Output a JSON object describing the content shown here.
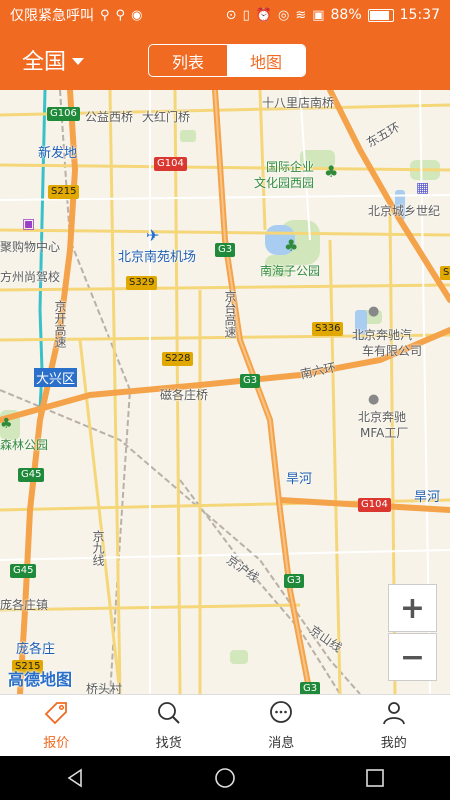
{
  "status_bar": {
    "left_text": "仅限紧急呼叫",
    "left_icons": [
      "usb-icon",
      "usb-icon",
      "weibo-icon"
    ],
    "right_icons": [
      "location-icon",
      "vibrate-icon",
      "alarm-icon",
      "eye-icon",
      "wifi-icon",
      "no-sim-icon"
    ],
    "battery_percent": "88%",
    "battery_level": 0.88,
    "time": "15:37"
  },
  "header": {
    "region": "全国",
    "tabs": [
      {
        "label": "列表",
        "active": false
      },
      {
        "label": "地图",
        "active": true
      }
    ]
  },
  "map": {
    "labels": {
      "shibali": "十八里店南桥",
      "gongyi": "公益西桥",
      "dahongmen": "大红门桥",
      "xinfadi": "新发地",
      "dongwuhuan": "东五环",
      "guojiqiye": "国际企业",
      "wenhuayuan": "文化园西园",
      "chengxiang": "北京城乡世纪",
      "jugouwu": "聚购物中心",
      "nanyuan": "北京南苑机场",
      "fangzhou": "方州尚驾校",
      "nanhaizi": "南海子公园",
      "jingkaigs": "京开高速",
      "jingtaigs": "京台高速",
      "benchi": "北京奔驰汽",
      "benchi2": "车有限公司",
      "daxingqu": "大兴区",
      "nanliuhuan": "南六环",
      "yingezhuang": "磁各庄桥",
      "benchimfa": "北京奔驰",
      "mfa": "MFA工厂",
      "senlin": "森林公园",
      "hanhe": "旱河",
      "hanhe2": "旱河",
      "jinghu": "京沪线",
      "jingjiu": "京九线",
      "jingshan": "京山线",
      "panggezhuangzhen": "庞各庄镇",
      "panggezhuang": "庞各庄",
      "qiaotou": "桥头村",
      "logo": "高德地图"
    },
    "shields": {
      "g106": "G106",
      "g104": "G104",
      "s215": "S215",
      "g3a": "G3",
      "s329": "S329",
      "s336": "S336",
      "s228": "S228",
      "g3b": "G3",
      "g45a": "G45",
      "g104b": "G104",
      "g45b": "G45",
      "g3c": "G3",
      "s215b": "S215",
      "g3d": "G3",
      "s_right": "S"
    },
    "zoom_in": "+",
    "zoom_out": "−"
  },
  "bottom_nav": [
    {
      "label": "报价",
      "icon": "tag-icon",
      "active": true
    },
    {
      "label": "找货",
      "icon": "search-icon",
      "active": false
    },
    {
      "label": "消息",
      "icon": "chat-icon",
      "active": false
    },
    {
      "label": "我的",
      "icon": "user-icon",
      "active": false
    }
  ],
  "colors": {
    "brand": "#f06a21",
    "highway": "#f4a34a",
    "road": "#f5d77a"
  }
}
